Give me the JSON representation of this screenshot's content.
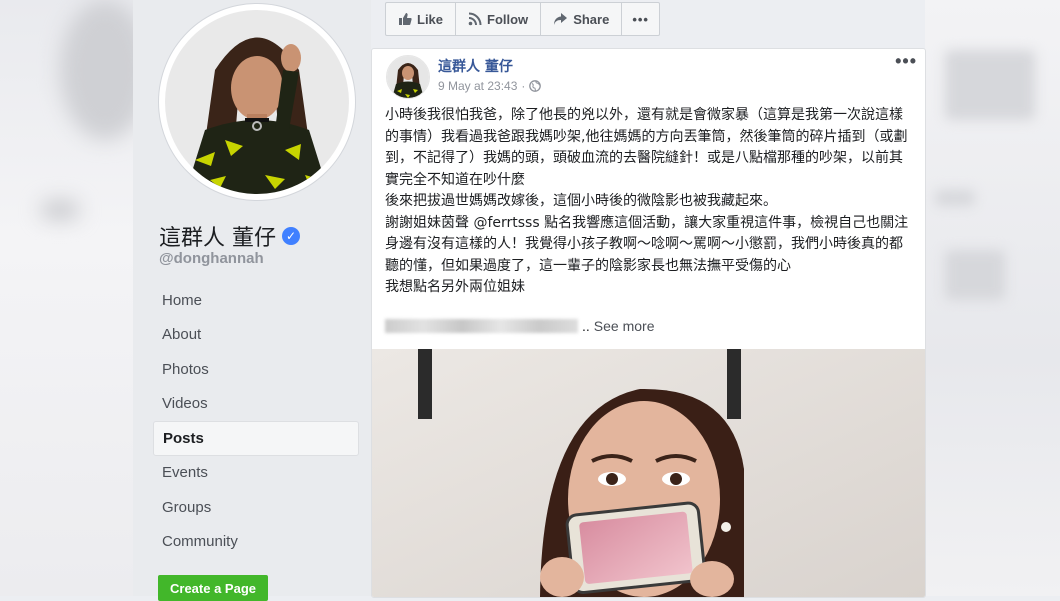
{
  "colors": {
    "brand_blue": "#385898",
    "sidebar_bg": "#e9ebee",
    "green_button": "#42b72a",
    "verified": "#4080ff"
  },
  "page": {
    "name": "這群人 董仔",
    "handle": "@donghannah",
    "verified_icon": "check-badge-icon"
  },
  "nav": [
    {
      "label": "Home"
    },
    {
      "label": "About"
    },
    {
      "label": "Photos"
    },
    {
      "label": "Videos"
    },
    {
      "label": "Posts",
      "active": true
    },
    {
      "label": "Events"
    },
    {
      "label": "Groups"
    },
    {
      "label": "Community"
    }
  ],
  "create_page_label": "Create a Page",
  "actions": {
    "like": "Like",
    "follow": "Follow",
    "share": "Share",
    "more": "•••"
  },
  "post": {
    "author": "這群人 董仔",
    "timestamp": "9 May at 23:43",
    "visibility_dot": "·",
    "menu": "•••",
    "paragraphs": [
      "小時後我很怕我爸，除了他長的兇以外，還有就是會微家暴（這算是我第一次說這樣的事情）我看過我爸跟我媽吵架,他往媽媽的方向丟筆筒，然後筆筒的碎片插到（或劃到，不記得了）我媽的頭，頭破血流的去醫院縫針！或是八點檔那種的吵架，以前其實完全不知道在吵什麼",
      "後來把拔過世媽媽改嫁後，這個小時後的微陰影也被我藏起來。",
      "謝謝姐妹茵聲 @ferrtsss 點名我響應這個活動，讓大家重視這件事，檢視自己也關注身邊有沒有這樣的人！我覺得小孩子教啊～唸啊～罵啊～小懲罰，我們小時後真的都聽的懂，但如果過度了，這一輩子的陰影家長也無法撫平受傷的心",
      "我想點名另外兩位姐妹"
    ],
    "see_more_prefix": "..",
    "see_more": "See more"
  }
}
